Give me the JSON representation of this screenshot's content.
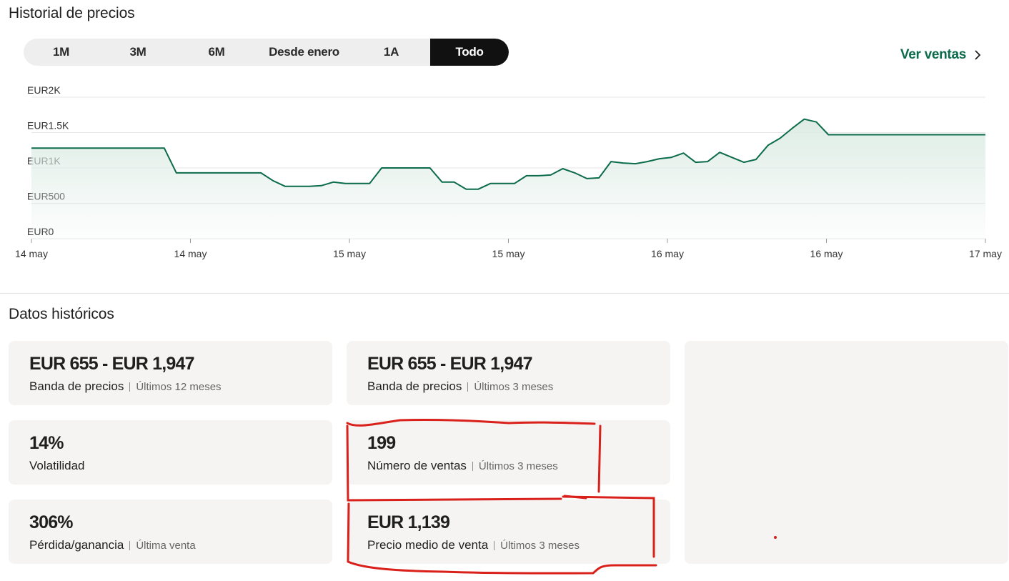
{
  "price_history": {
    "title": "Historial de precios",
    "tabs": [
      {
        "label": "1M",
        "active": false
      },
      {
        "label": "3M",
        "active": false
      },
      {
        "label": "6M",
        "active": false
      },
      {
        "label": "Desde enero",
        "active": false
      },
      {
        "label": "1A",
        "active": false
      },
      {
        "label": "Todo",
        "active": true
      }
    ],
    "see_sales_label": "Ver ventas"
  },
  "chart_data": {
    "type": "area",
    "y_tick_labels": [
      "EUR2K",
      "EUR1.5K",
      "EUR1K",
      "EUR500",
      "EUR0"
    ],
    "y_ticks": [
      2000,
      1500,
      1000,
      500,
      0
    ],
    "ylim": [
      0,
      2000
    ],
    "x_tick_labels": [
      "14 may",
      "14 may",
      "15 may",
      "15 may",
      "16 may",
      "16 may",
      "17 may"
    ],
    "grid": true,
    "line_color": "#0b6b4b",
    "values": [
      1280,
      1280,
      1280,
      1280,
      1280,
      1280,
      1280,
      1280,
      1280,
      1280,
      1280,
      1280,
      930,
      930,
      930,
      930,
      930,
      930,
      930,
      930,
      820,
      740,
      740,
      740,
      750,
      800,
      780,
      780,
      780,
      1000,
      1000,
      1000,
      1000,
      1000,
      800,
      800,
      700,
      700,
      780,
      780,
      780,
      890,
      890,
      900,
      990,
      930,
      850,
      860,
      1090,
      1070,
      1060,
      1090,
      1130,
      1150,
      1210,
      1080,
      1090,
      1220,
      1150,
      1080,
      1120,
      1320,
      1420,
      1560,
      1690,
      1650,
      1470,
      1470,
      1470,
      1470,
      1470,
      1470,
      1470,
      1470,
      1470,
      1470,
      1470,
      1470,
      1470,
      1470
    ],
    "fill_color": "#dcebe4"
  },
  "historical": {
    "title": "Datos históricos",
    "cards": [
      {
        "value": "EUR 655 - EUR 1,947",
        "label": "Banda de precios",
        "sub": "Últimos 12 meses"
      },
      {
        "value": "EUR 655 - EUR 1,947",
        "label": "Banda de precios",
        "sub": "Últimos 3 meses"
      },
      {
        "value": "14%",
        "label": "Volatilidad",
        "sub": ""
      },
      {
        "value": "199",
        "label": "Número de ventas",
        "sub": "Últimos 3 meses"
      },
      {
        "value": "306%",
        "label": "Pérdida/ganancia",
        "sub": "Última venta"
      },
      {
        "value": "EUR 1,139",
        "label": "Precio medio de venta",
        "sub": "Últimos 3 meses"
      }
    ]
  },
  "annotation_color": "#d9201b",
  "colors": {
    "accent": "#0b6b4b",
    "card_bg": "#f5f4f2",
    "active_tab": "#111111"
  }
}
